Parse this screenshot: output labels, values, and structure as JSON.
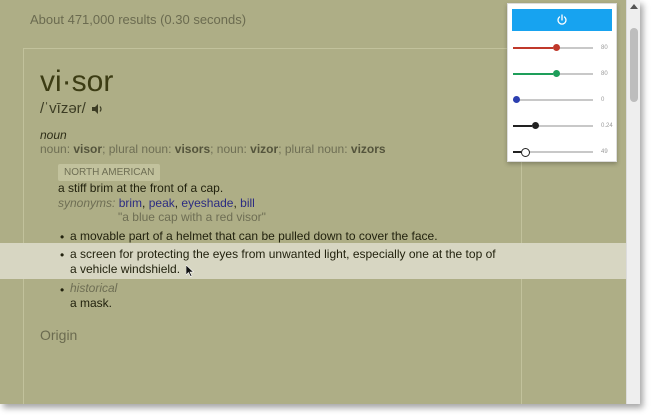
{
  "results": {
    "stats": "About 471,000 results (0.30 seconds)"
  },
  "entry": {
    "word": "vi·sor",
    "phonetic": "/ˈvīzər/",
    "pos": "noun",
    "forms": [
      {
        "label": "noun: ",
        "value": "visor"
      },
      {
        "label": "; plural noun: ",
        "value": "visors"
      },
      {
        "label": "; noun: ",
        "value": "vizor"
      },
      {
        "label": "; plural noun: ",
        "value": "vizors"
      }
    ],
    "region": "NORTH AMERICAN",
    "def1": "a stiff brim at the front of a cap.",
    "synonyms_label": "synonyms:",
    "synonyms": [
      "brim",
      "peak",
      "eyeshade",
      "bill"
    ],
    "example": "\"a blue cap with a red visor\"",
    "def2": "a movable part of a helmet that can be pulled down to cover the face.",
    "def3_line1": "a screen for protecting the eyes from unwanted light, especially one at the top of",
    "def3_line2": "a vehicle windshield.",
    "historical_label": "historical",
    "def4": "a mask.",
    "origin": "Origin"
  },
  "panel": {
    "accent": "#17a3f0",
    "icon": "power-icon",
    "sliders": [
      {
        "name": "red",
        "value": "80",
        "level": 0.5,
        "color": "#c0392b"
      },
      {
        "name": "green",
        "value": "80",
        "level": 0.5,
        "color": "#1e9e5a"
      },
      {
        "name": "blue",
        "value": "0",
        "level": 0.0,
        "color": "#2c3fb0"
      },
      {
        "name": "opacity",
        "value": "0.24",
        "level": 0.24,
        "color": "#222222"
      },
      {
        "name": "contrast",
        "value": "49",
        "level": 0.1,
        "color": "#222222"
      }
    ]
  },
  "colors": {
    "overlay_tint": "#aeae86",
    "highlight_row": "#d7d6c2"
  }
}
